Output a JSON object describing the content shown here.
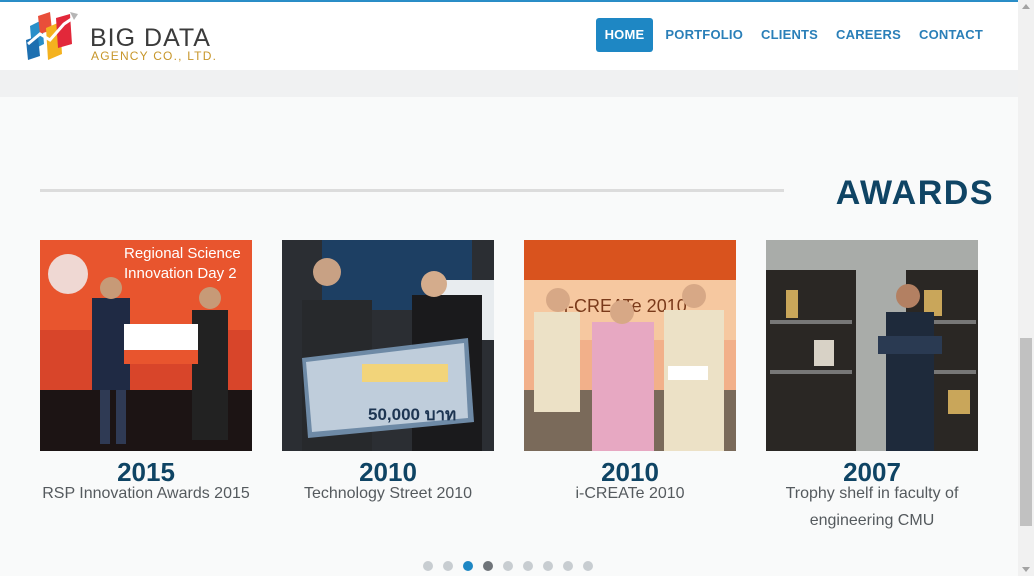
{
  "brand": {
    "title": "BIG DATA",
    "subtitle": "AGENCY CO., LTD."
  },
  "nav": {
    "items": [
      {
        "label": "HOME",
        "active": true
      },
      {
        "label": "PORTFOLIO",
        "active": false
      },
      {
        "label": "CLIENTS",
        "active": false
      },
      {
        "label": "CAREERS",
        "active": false
      },
      {
        "label": "CONTACT",
        "active": false
      }
    ]
  },
  "awards": {
    "heading": "AWARDS",
    "cards": [
      {
        "year": "2015",
        "caption": "RSP Innovation Awards 2015",
        "photo_text": "Regional Science Innovation Day 2"
      },
      {
        "year": "2010",
        "caption": "Technology Street 2010",
        "photo_text": "50,000 บาท"
      },
      {
        "year": "2010",
        "caption": "i-CREATe 2010",
        "photo_text": "i-CREATe 2010"
      },
      {
        "year": "2007",
        "caption": "Trophy shelf in faculty of engineering CMU",
        "photo_text": ""
      }
    ]
  },
  "carousel": {
    "dot_count": 9,
    "active_index": 2,
    "current_index": 3
  },
  "colors": {
    "accent": "#1e87c4",
    "heading": "#0f4464",
    "logo_gold": "#c7962a"
  }
}
